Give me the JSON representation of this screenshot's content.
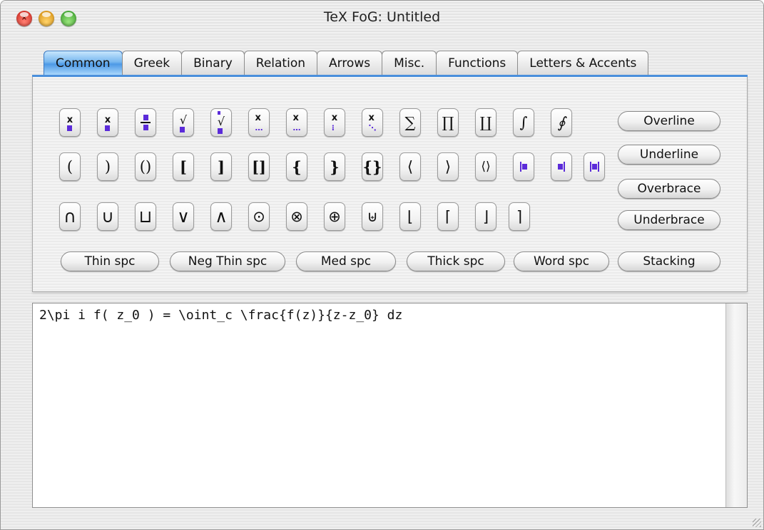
{
  "window": {
    "title": "TeX FoG: Untitled"
  },
  "tabs": [
    "Common",
    "Greek",
    "Binary",
    "Relation",
    "Arrows",
    "Misc.",
    "Functions",
    "Letters & Accents"
  ],
  "symbols": {
    "row1": [
      "x",
      "x",
      "frac",
      "√",
      "√",
      "x",
      "x",
      "x",
      "x",
      "∑",
      "∏",
      "∐",
      "∫",
      "∮"
    ],
    "row2": [
      "(",
      ")",
      "()",
      "[",
      "]",
      "[]",
      "{",
      "}",
      "{}",
      "⟨",
      "⟩",
      "⟨⟩",
      "|▪",
      "▪|",
      "|▪|"
    ],
    "row3": [
      "∩",
      "∪",
      "⊔",
      "∨",
      "∧",
      "⊙",
      "⊗",
      "⊕",
      "⊎",
      "⌊",
      "⌈",
      "⌋",
      "⌉"
    ]
  },
  "side_buttons": [
    "Overline",
    "Underline",
    "Overbrace",
    "Underbrace",
    "Stacking"
  ],
  "space_buttons": [
    "Thin spc",
    "Neg Thin spc",
    "Med spc",
    "Thick spc",
    "Word spc"
  ],
  "editor": {
    "value": "2\\pi i f( z_0 ) = \\oint_c \\frac{f(z)}{z-z_0} dz"
  },
  "colors": {
    "tab_active": "#5aa8ee",
    "glyph_accent": "#5b2bd9"
  },
  "icons": {
    "close": "close-icon",
    "minimize": "minimize-icon",
    "zoom": "zoom-icon"
  }
}
